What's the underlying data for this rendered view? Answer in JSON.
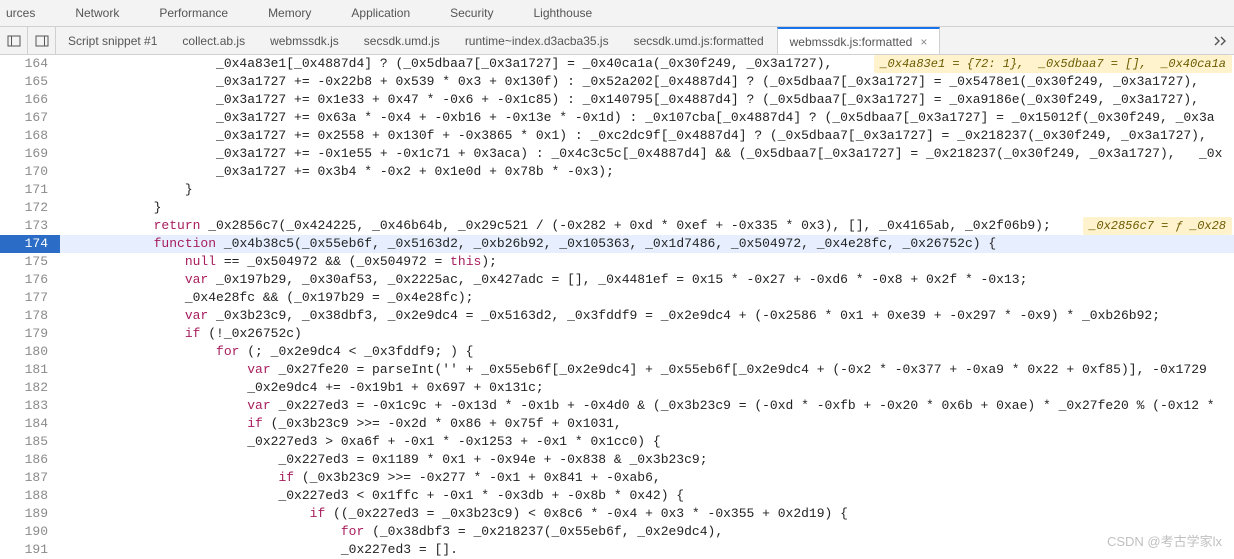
{
  "panels": [
    {
      "label": "urces"
    },
    {
      "label": "Network"
    },
    {
      "label": "Performance"
    },
    {
      "label": "Memory"
    },
    {
      "label": "Application"
    },
    {
      "label": "Security"
    },
    {
      "label": "Lighthouse"
    }
  ],
  "file_tabs": [
    {
      "label": "Script snippet #1"
    },
    {
      "label": "collect.ab.js"
    },
    {
      "label": "webmssdk.js"
    },
    {
      "label": "secsdk.umd.js"
    },
    {
      "label": "runtime~index.d3acba35.js"
    },
    {
      "label": "secsdk.umd.js:formatted"
    },
    {
      "label": "webmssdk.js:formatted",
      "active": true
    }
  ],
  "highlighted_line": 174,
  "inline_hints": {
    "164": "_0x4a83e1 = {72: 1},  _0x5dbaa7 = [],  _0x40ca1a",
    "173": "_0x2856c7 = ƒ _0x28"
  },
  "code_lines": [
    {
      "n": 164,
      "text": "                    _0x4a83e1[_0x4887d4] ? (_0x5dbaa7[_0x3a1727] = _0x40ca1a(_0x30f249, _0x3a1727),"
    },
    {
      "n": 165,
      "text": "                    _0x3a1727 += -0x22b8 + 0x539 * 0x3 + 0x130f) : _0x52a202[_0x4887d4] ? (_0x5dbaa7[_0x3a1727] = _0x5478e1(_0x30f249, _0x3a1727),"
    },
    {
      "n": 166,
      "text": "                    _0x3a1727 += 0x1e33 + 0x47 * -0x6 + -0x1c85) : _0x140795[_0x4887d4] ? (_0x5dbaa7[_0x3a1727] = _0xa9186e(_0x30f249, _0x3a1727),"
    },
    {
      "n": 167,
      "text": "                    _0x3a1727 += 0x63a * -0x4 + -0xb16 + -0x13e * -0x1d) : _0x107cba[_0x4887d4] ? (_0x5dbaa7[_0x3a1727] = _0x15012f(_0x30f249, _0x3a"
    },
    {
      "n": 168,
      "text": "                    _0x3a1727 += 0x2558 + 0x130f + -0x3865 * 0x1) : _0xc2dc9f[_0x4887d4] ? (_0x5dbaa7[_0x3a1727] = _0x218237(_0x30f249, _0x3a1727),"
    },
    {
      "n": 169,
      "text": "                    _0x3a1727 += -0x1e55 + -0x1c71 + 0x3aca) : _0x4c3c5c[_0x4887d4] && (_0x5dbaa7[_0x3a1727] = _0x218237(_0x30f249, _0x3a1727),   _0x"
    },
    {
      "n": 170,
      "text": "                    _0x3a1727 += 0x3b4 * -0x2 + 0x1e0d + 0x78b * -0x3);"
    },
    {
      "n": 171,
      "text": "                }"
    },
    {
      "n": 172,
      "text": "            }"
    },
    {
      "n": 173,
      "text": "            return _0x2856c7(_0x424225, _0x46b64b, _0x29c521 / (-0x282 + 0xd * 0xef + -0x335 * 0x3), [], _0x4165ab, _0x2f06b9);"
    },
    {
      "n": 174,
      "text": "            function _0x4b38c5(_0x55eb6f, _0x5163d2, _0xb26b92, _0x105363, _0x1d7486, _0x504972, _0x4e28fc, _0x26752c) {"
    },
    {
      "n": 175,
      "text": "                null == _0x504972 && (_0x504972 = this);"
    },
    {
      "n": 176,
      "text": "                var _0x197b29, _0x30af53, _0x2225ac, _0x427adc = [], _0x4481ef = 0x15 * -0x27 + -0xd6 * -0x8 + 0x2f * -0x13;"
    },
    {
      "n": 177,
      "text": "                _0x4e28fc && (_0x197b29 = _0x4e28fc);"
    },
    {
      "n": 178,
      "text": "                var _0x3b23c9, _0x38dbf3, _0x2e9dc4 = _0x5163d2, _0x3fddf9 = _0x2e9dc4 + (-0x2586 * 0x1 + 0xe39 + -0x297 * -0x9) * _0xb26b92;"
    },
    {
      "n": 179,
      "text": "                if (!_0x26752c)"
    },
    {
      "n": 180,
      "text": "                    for (; _0x2e9dc4 < _0x3fddf9; ) {"
    },
    {
      "n": 181,
      "text": "                        var _0x27fe20 = parseInt('' + _0x55eb6f[_0x2e9dc4] + _0x55eb6f[_0x2e9dc4 + (-0x2 * -0x377 + -0xa9 * 0x22 + 0xf85)], -0x1729"
    },
    {
      "n": 182,
      "text": "                        _0x2e9dc4 += -0x19b1 + 0x697 + 0x131c;"
    },
    {
      "n": 183,
      "text": "                        var _0x227ed3 = -0x1c9c + -0x13d * -0x1b + -0x4d0 & (_0x3b23c9 = (-0xd * -0xfb + -0x20 * 0x6b + 0xae) * _0x27fe20 % (-0x12 *"
    },
    {
      "n": 184,
      "text": "                        if (_0x3b23c9 >>= -0x2d * 0x86 + 0x75f + 0x1031,"
    },
    {
      "n": 185,
      "text": "                        _0x227ed3 > 0xa6f + -0x1 * -0x1253 + -0x1 * 0x1cc0) {"
    },
    {
      "n": 186,
      "text": "                            _0x227ed3 = 0x1189 * 0x1 + -0x94e + -0x838 & _0x3b23c9;"
    },
    {
      "n": 187,
      "text": "                            if (_0x3b23c9 >>= -0x277 * -0x1 + 0x841 + -0xab6,"
    },
    {
      "n": 188,
      "text": "                            _0x227ed3 < 0x1ffc + -0x1 * -0x3db + -0x8b * 0x42) {"
    },
    {
      "n": 189,
      "text": "                                if ((_0x227ed3 = _0x3b23c9) < 0x8c6 * -0x4 + 0x3 * -0x355 + 0x2d19) {"
    },
    {
      "n": 190,
      "text": "                                    for (_0x38dbf3 = _0x218237(_0x55eb6f, _0x2e9dc4),"
    },
    {
      "n": 191,
      "text": "                                    _0x227ed3 = []."
    }
  ],
  "watermark": "CSDN @考古学家lx"
}
